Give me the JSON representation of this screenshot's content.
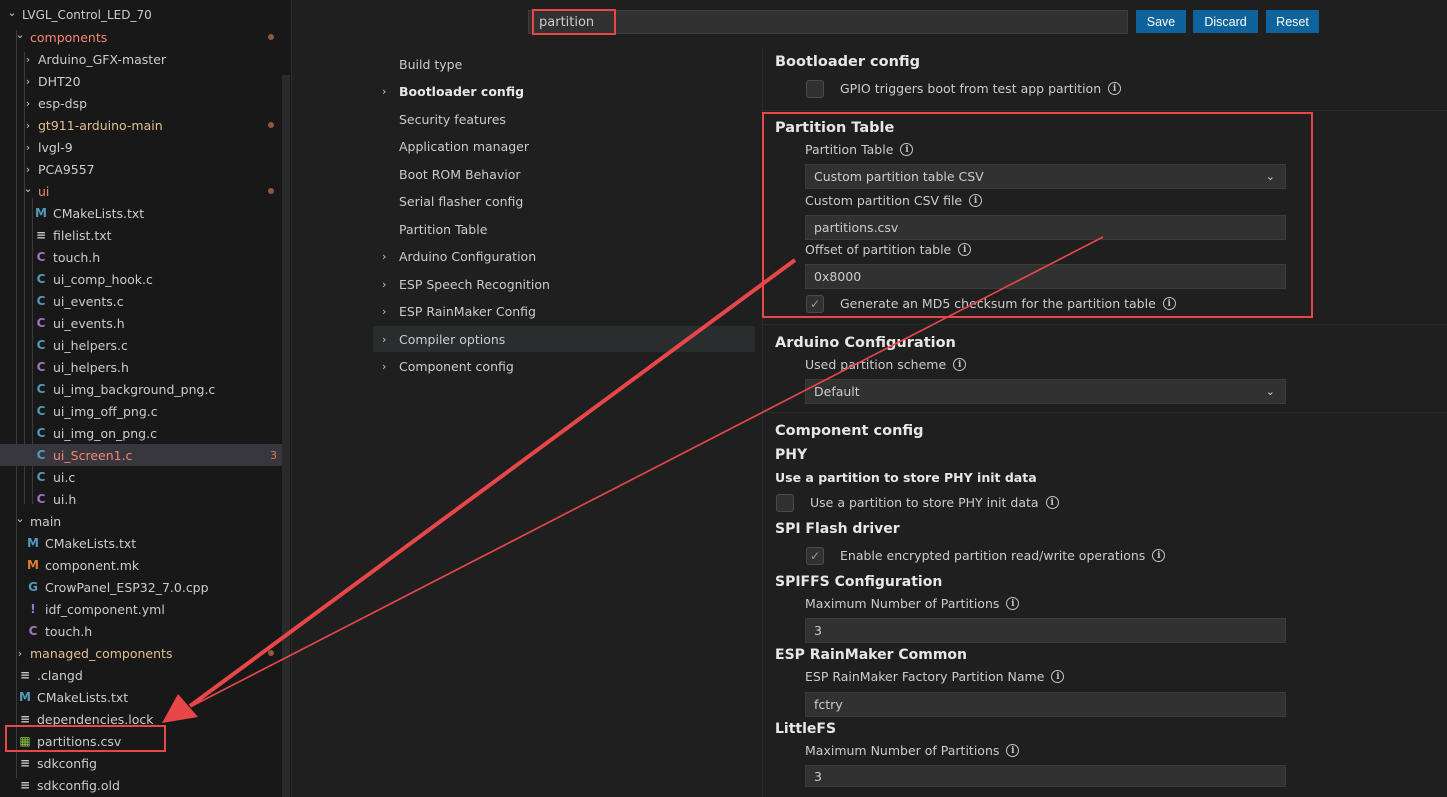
{
  "explorer": {
    "items": [
      {
        "label": "LVGL_Control_LED_70",
        "indent": 0,
        "chev": "v",
        "type": "root",
        "status": ""
      },
      {
        "label": "components",
        "indent": 1,
        "chev": "v",
        "type": "folder",
        "status": "mod-err"
      },
      {
        "label": "Arduino_GFX-master",
        "indent": 2,
        "chev": ">",
        "type": "folder",
        "status": ""
      },
      {
        "label": "DHT20",
        "indent": 2,
        "chev": ">",
        "type": "folder",
        "status": ""
      },
      {
        "label": "esp-dsp",
        "indent": 2,
        "chev": ">",
        "type": "folder",
        "status": ""
      },
      {
        "label": "gt911-arduino-main",
        "indent": 2,
        "chev": ">",
        "type": "folder",
        "status": "mod"
      },
      {
        "label": "lvgl-9",
        "indent": 2,
        "chev": ">",
        "type": "folder",
        "status": ""
      },
      {
        "label": "PCA9557",
        "indent": 2,
        "chev": ">",
        "type": "folder",
        "status": ""
      },
      {
        "label": "ui",
        "indent": 2,
        "chev": "v",
        "type": "folder",
        "status": "mod-err"
      },
      {
        "label": "CMakeLists.txt",
        "indent": 3,
        "chev": "",
        "type": "M",
        "status": ""
      },
      {
        "label": "filelist.txt",
        "indent": 3,
        "chev": "",
        "type": "lines",
        "status": ""
      },
      {
        "label": "touch.h",
        "indent": 3,
        "chev": "",
        "type": "Ch",
        "status": ""
      },
      {
        "label": "ui_comp_hook.c",
        "indent": 3,
        "chev": "",
        "type": "C",
        "status": ""
      },
      {
        "label": "ui_events.c",
        "indent": 3,
        "chev": "",
        "type": "C",
        "status": ""
      },
      {
        "label": "ui_events.h",
        "indent": 3,
        "chev": "",
        "type": "Ch",
        "status": ""
      },
      {
        "label": "ui_helpers.c",
        "indent": 3,
        "chev": "",
        "type": "C",
        "status": ""
      },
      {
        "label": "ui_helpers.h",
        "indent": 3,
        "chev": "",
        "type": "Ch",
        "status": ""
      },
      {
        "label": "ui_img_background_png.c",
        "indent": 3,
        "chev": "",
        "type": "C",
        "status": ""
      },
      {
        "label": "ui_img_off_png.c",
        "indent": 3,
        "chev": "",
        "type": "C",
        "status": ""
      },
      {
        "label": "ui_img_on_png.c",
        "indent": 3,
        "chev": "",
        "type": "C",
        "status": ""
      },
      {
        "label": "ui_Screen1.c",
        "indent": 3,
        "chev": "",
        "type": "C",
        "status": "err",
        "count": "3",
        "selected": true
      },
      {
        "label": "ui.c",
        "indent": 3,
        "chev": "",
        "type": "C",
        "status": ""
      },
      {
        "label": "ui.h",
        "indent": 3,
        "chev": "",
        "type": "Ch",
        "status": ""
      },
      {
        "label": "main",
        "indent": 1,
        "chev": "v",
        "type": "folder",
        "status": ""
      },
      {
        "label": "CMakeLists.txt",
        "indent": 2,
        "chev": "",
        "type": "M",
        "status": ""
      },
      {
        "label": "component.mk",
        "indent": 2,
        "chev": "",
        "type": "Mo",
        "status": ""
      },
      {
        "label": "CrowPanel_ESP32_7.0.cpp",
        "indent": 2,
        "chev": "",
        "type": "Cpp",
        "status": ""
      },
      {
        "label": "idf_component.yml",
        "indent": 2,
        "chev": "",
        "type": "Ex",
        "status": ""
      },
      {
        "label": "touch.h",
        "indent": 2,
        "chev": "",
        "type": "Ch",
        "status": ""
      },
      {
        "label": "managed_components",
        "indent": 1,
        "chev": ">",
        "type": "folder",
        "status": "mod-dot"
      },
      {
        "label": ".clangd",
        "indent": 1,
        "chev": "",
        "type": "lines",
        "status": ""
      },
      {
        "label": "CMakeLists.txt",
        "indent": 1,
        "chev": "",
        "type": "M",
        "status": ""
      },
      {
        "label": "dependencies.lock",
        "indent": 1,
        "chev": "",
        "type": "lines",
        "status": ""
      },
      {
        "label": "partitions.csv",
        "indent": 1,
        "chev": "",
        "type": "grid",
        "status": ""
      },
      {
        "label": "sdkconfig",
        "indent": 1,
        "chev": "",
        "type": "lines",
        "status": ""
      },
      {
        "label": "sdkconfig.old",
        "indent": 1,
        "chev": "",
        "type": "lines",
        "status": ""
      }
    ]
  },
  "search": {
    "value": "partition"
  },
  "buttons": {
    "save": "Save",
    "discard": "Discard",
    "reset": "Reset"
  },
  "toc": [
    {
      "label": "Build type",
      "chev": ""
    },
    {
      "label": "Bootloader config",
      "chev": ">",
      "bold": true
    },
    {
      "label": "Security features",
      "chev": ""
    },
    {
      "label": "Application manager",
      "chev": ""
    },
    {
      "label": "Boot ROM Behavior",
      "chev": ""
    },
    {
      "label": "Serial flasher config",
      "chev": ""
    },
    {
      "label": "Partition Table",
      "chev": ""
    },
    {
      "label": "Arduino Configuration",
      "chev": ">"
    },
    {
      "label": "ESP Speech Recognition",
      "chev": ">"
    },
    {
      "label": "ESP RainMaker Config",
      "chev": ">"
    },
    {
      "label": "Compiler options",
      "chev": ">",
      "active": true
    },
    {
      "label": "Component config",
      "chev": ">"
    }
  ],
  "settings": {
    "bootloader": {
      "title": "Bootloader config",
      "gpio_label": "GPIO triggers boot from test app partition",
      "gpio_checked": false
    },
    "partition_table": {
      "title": "Partition Table",
      "table_label": "Partition Table",
      "table_value": "Custom partition table CSV",
      "csv_label": "Custom partition CSV file",
      "csv_value": "partitions.csv",
      "offset_label": "Offset of partition table",
      "offset_value": "0x8000",
      "md5_label": "Generate an MD5 checksum for the partition table",
      "md5_checked": true
    },
    "arduino": {
      "title": "Arduino Configuration",
      "scheme_label": "Used partition scheme",
      "scheme_value": "Default"
    },
    "component": {
      "title": "Component config",
      "phy_title": "PHY",
      "phy_desc": "Use a partition to store PHY init data",
      "phy_label": "Use a partition to store PHY init data",
      "phy_checked": false,
      "spi_title": "SPI Flash driver",
      "spi_label": "Enable encrypted partition read/write operations",
      "spi_checked": true,
      "spiffs_title": "SPIFFS Configuration",
      "spiffs_label": "Maximum Number of Partitions",
      "spiffs_value": "3",
      "rainmaker_title": "ESP RainMaker Common",
      "rainmaker_label": "ESP RainMaker Factory Partition Name",
      "rainmaker_value": "fctry",
      "littlefs_title": "LittleFS",
      "littlefs_label": "Maximum Number of Partitions",
      "littlefs_value": "3"
    }
  },
  "colors": {
    "accent": "#0e639c",
    "highlight": "#e8474a",
    "modified": "#e2c08d",
    "error": "#f48771"
  }
}
